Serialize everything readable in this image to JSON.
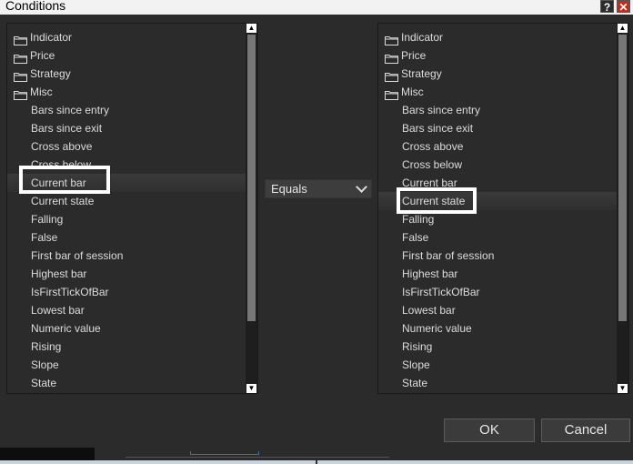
{
  "window": {
    "title": "Conditions",
    "help_label": "?",
    "close_label": "✕"
  },
  "left_tree": {
    "folders": [
      "Indicator",
      "Price",
      "Strategy",
      "Misc"
    ],
    "items": [
      "Bars since entry",
      "Bars since exit",
      "Cross above",
      "Cross below",
      "Current bar",
      "Current state",
      "Falling",
      "False",
      "First bar of session",
      "Highest bar",
      "IsFirstTickOfBar",
      "Lowest bar",
      "Numeric value",
      "Rising",
      "Slope",
      "State"
    ],
    "selected": "Current bar"
  },
  "right_tree": {
    "folders": [
      "Indicator",
      "Price",
      "Strategy",
      "Misc"
    ],
    "items": [
      "Bars since entry",
      "Bars since exit",
      "Cross above",
      "Cross below",
      "Current bar",
      "Current state",
      "Falling",
      "False",
      "First bar of session",
      "Highest bar",
      "IsFirstTickOfBar",
      "Lowest bar",
      "Numeric value",
      "Rising",
      "Slope",
      "State"
    ],
    "selected": "Current state"
  },
  "operator": {
    "value": "Equals"
  },
  "buttons": {
    "ok": "OK",
    "cancel": "Cancel"
  },
  "icons": {
    "folder": "folder-icon",
    "scroll_up": "scroll-up-arrow-icon",
    "scroll_down": "scroll-down-arrow-icon",
    "dropdown": "chevron-down-icon"
  }
}
